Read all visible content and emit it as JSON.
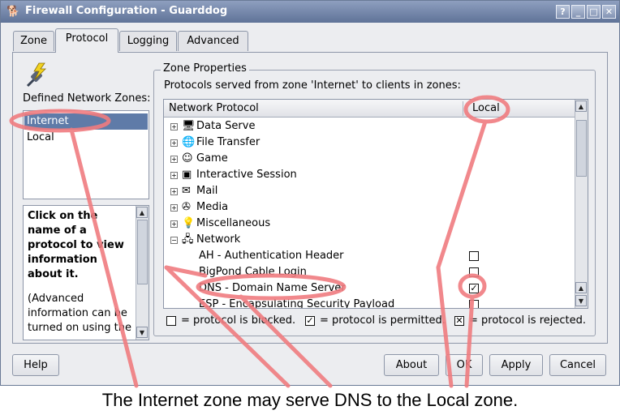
{
  "window": {
    "title": "Firewall Configuration - Guarddog",
    "controls": {
      "help": "?",
      "minimize": "_",
      "maximize": "□",
      "close": "✕"
    },
    "app_icon": "guarddog-icon"
  },
  "tabs": [
    {
      "label": "Zone",
      "active": false
    },
    {
      "label": "Protocol",
      "active": true
    },
    {
      "label": "Logging",
      "active": false
    },
    {
      "label": "Advanced",
      "active": false
    }
  ],
  "left": {
    "zones_label": "Defined Network Zones:",
    "zones": [
      {
        "label": "Internet",
        "selected": true
      },
      {
        "label": "Local",
        "selected": false
      }
    ],
    "info_bold": "Click on the name of a protocol to view information about it.",
    "info_normal": "(Advanced information can be turned on using the"
  },
  "zone_properties": {
    "legend": "Zone Properties",
    "served_label": "Protocols served from zone 'Internet' to clients in zones:",
    "columns": {
      "protocol": "Network Protocol",
      "local": "Local"
    },
    "categories": [
      {
        "label": "Data Serve",
        "icon": "data-serve-icon"
      },
      {
        "label": "File Transfer",
        "icon": "file-transfer-icon"
      },
      {
        "label": "Game",
        "icon": "game-icon"
      },
      {
        "label": "Interactive Session",
        "icon": "interactive-session-icon"
      },
      {
        "label": "Mail",
        "icon": "mail-icon"
      },
      {
        "label": "Media",
        "icon": "media-icon"
      },
      {
        "label": "Miscellaneous",
        "icon": "miscellaneous-icon"
      },
      {
        "label": "Network",
        "icon": "network-icon",
        "expanded": true
      }
    ],
    "network_items": [
      {
        "label": "AH - Authentication Header",
        "state": "blocked"
      },
      {
        "label": "BigPond Cable Login",
        "state": "blocked"
      },
      {
        "label": "DNS - Domain Name Server",
        "state": "permitted"
      },
      {
        "label": "ESP - Encapsulating Security Payload",
        "state": "blocked"
      }
    ],
    "legend_items": {
      "blocked": "= protocol is blocked.",
      "permitted": "= protocol is permitted.",
      "rejected": "= protocol is rejected."
    }
  },
  "buttons": {
    "help": "Help",
    "about": "About",
    "ok": "OK",
    "apply": "Apply",
    "cancel": "Cancel"
  },
  "caption": "The Internet zone may serve DNS to the Local zone.",
  "colors": {
    "annotation": "#f07c80",
    "selection": "#5f7ba8",
    "titlebar": "#6f82a6"
  }
}
